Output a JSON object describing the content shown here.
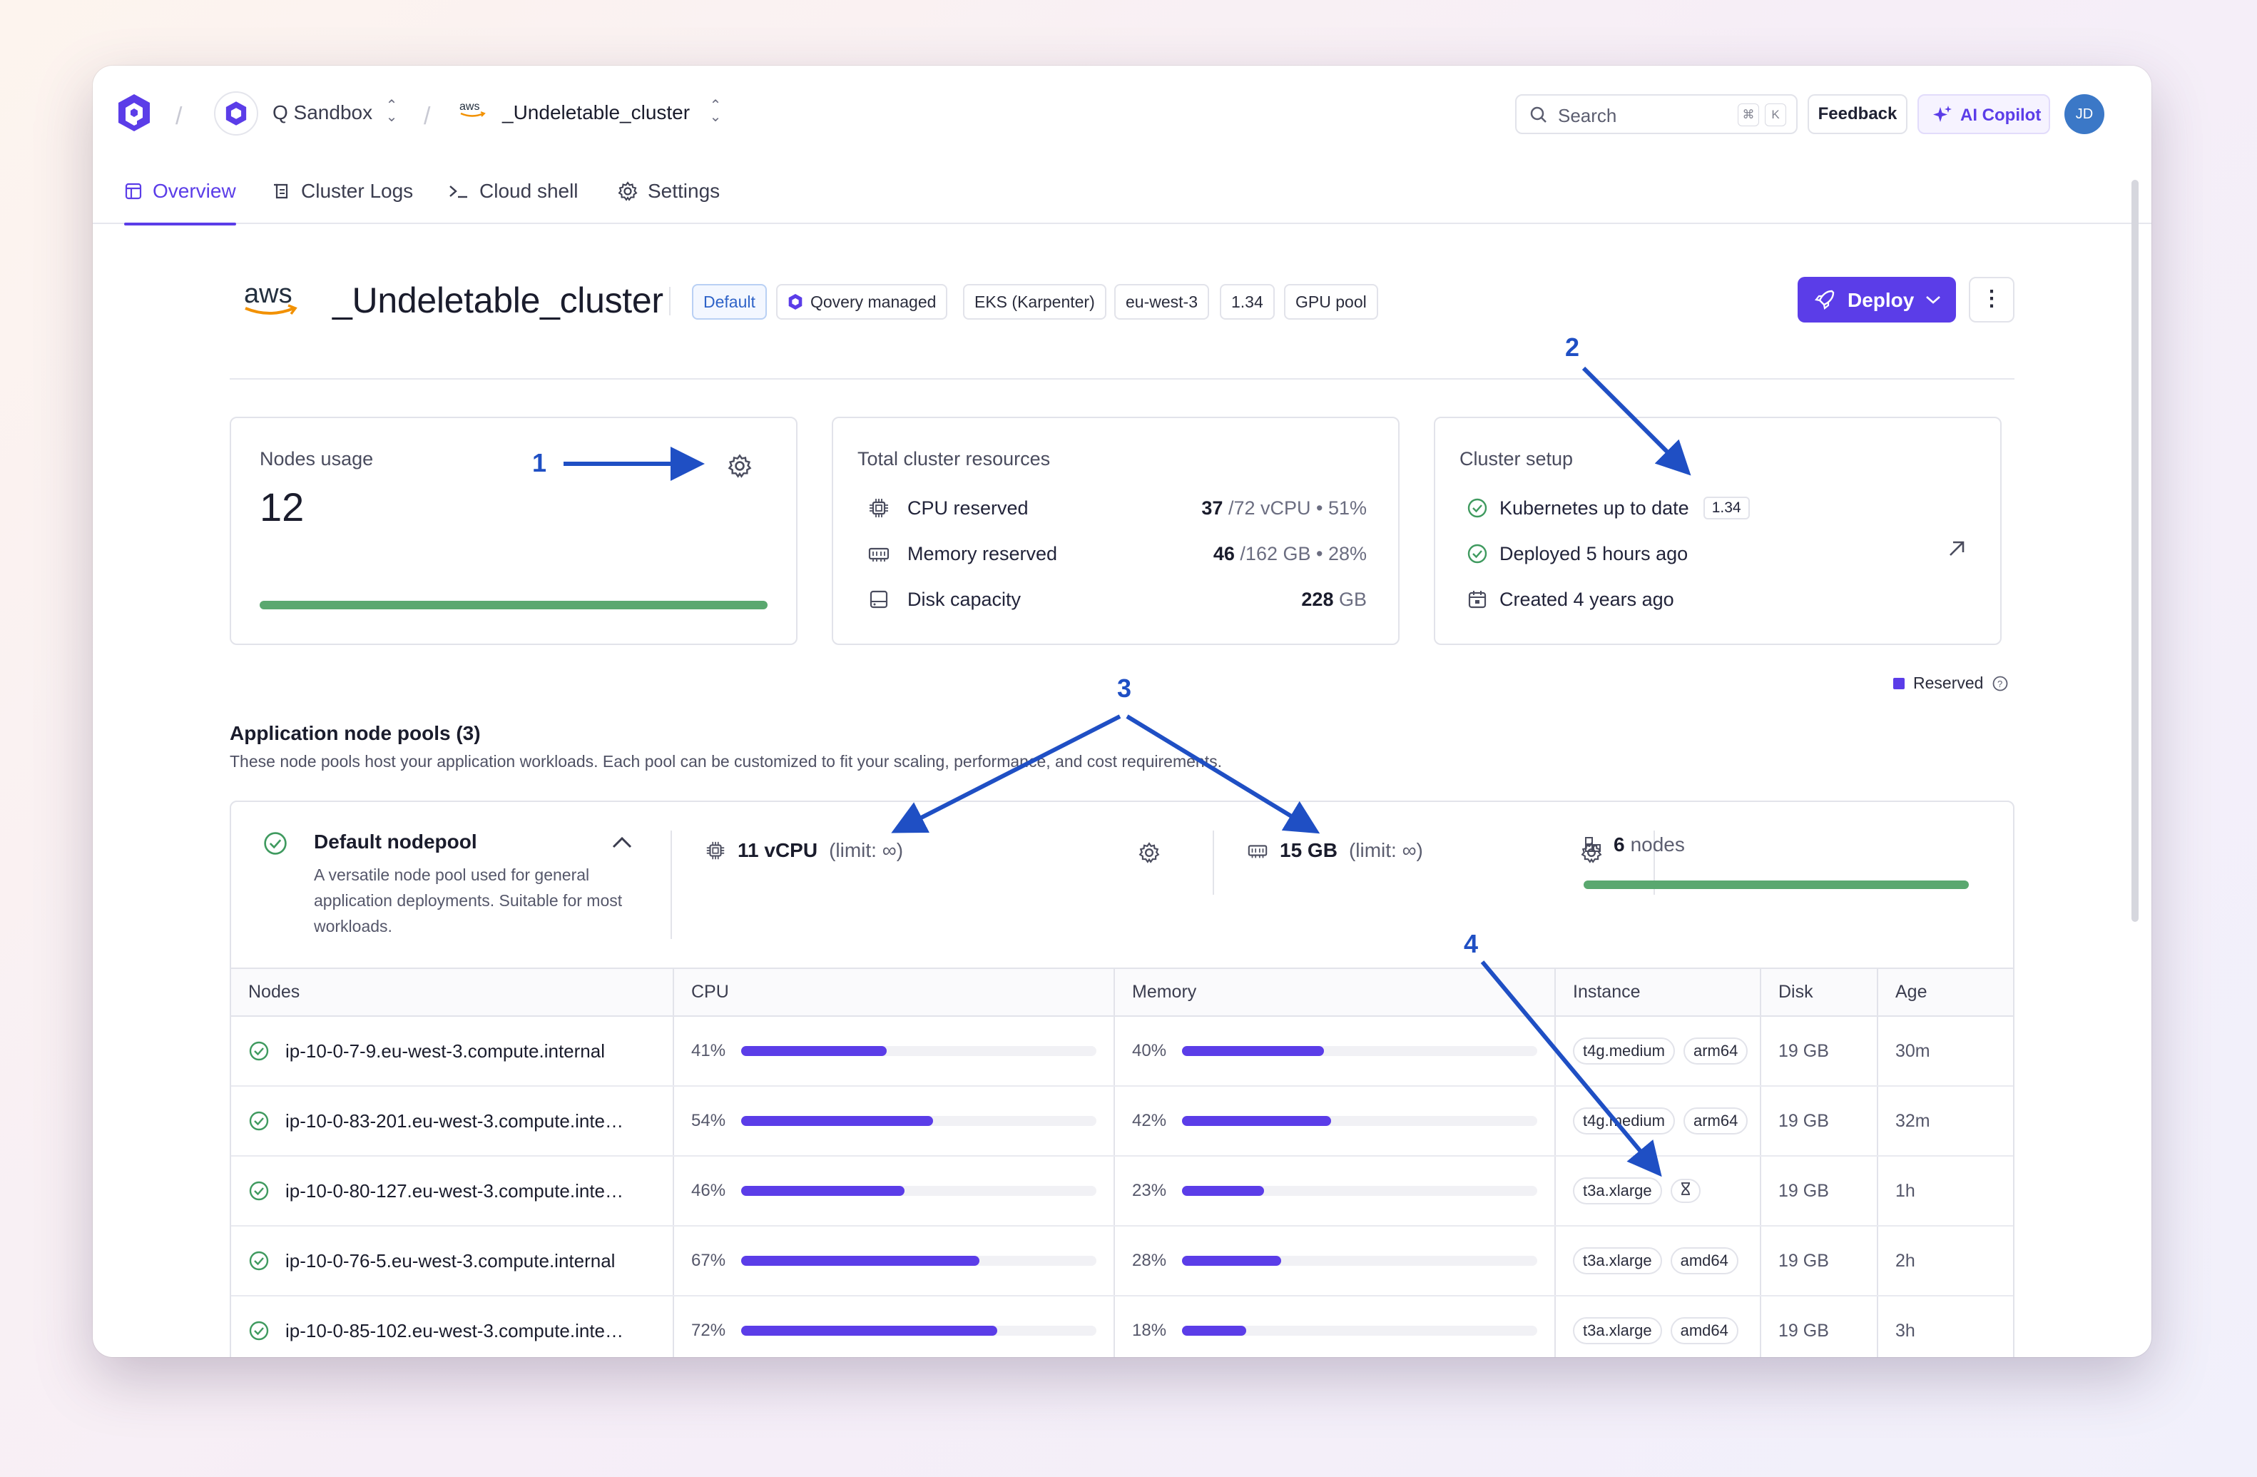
{
  "breadcrumb": {
    "project": "Q Sandbox",
    "cluster_provider": "aws",
    "cluster": "_Undeletable_cluster"
  },
  "topbar": {
    "search_placeholder": "Search",
    "shortcut_1": "⌘",
    "shortcut_2": "K",
    "feedback": "Feedback",
    "copilot": "AI Copilot",
    "user_initials": "JD"
  },
  "tabs": [
    {
      "label": "Overview",
      "icon": "layout-icon",
      "active": true
    },
    {
      "label": "Cluster Logs",
      "icon": "logs-icon",
      "active": false
    },
    {
      "label": "Cloud shell",
      "icon": "terminal-icon",
      "active": false
    },
    {
      "label": "Settings",
      "icon": "gear-icon",
      "active": false
    }
  ],
  "header": {
    "provider_logo": "aws",
    "title": "_Undeletable_cluster",
    "badges": [
      "Default",
      "Qovery managed",
      "EKS (Karpenter)",
      "eu-west-3",
      "1.34",
      "GPU pool"
    ],
    "deploy_label": "Deploy",
    "more_label": "⋮"
  },
  "nodes_usage": {
    "title": "Nodes usage",
    "count": "12",
    "usage_fraction": 1.0
  },
  "total_resources": {
    "title": "Total cluster resources",
    "rows": [
      {
        "name": "CPU reserved",
        "used": "37",
        "total": "/72 vCPU",
        "pct": "51%"
      },
      {
        "name": "Memory reserved",
        "used": "46",
        "total": "/162 GB",
        "pct": "28%"
      },
      {
        "name": "Disk capacity",
        "used": "228",
        "total": "GB",
        "pct": ""
      }
    ]
  },
  "cluster_setup": {
    "title": "Cluster setup",
    "k8s": "Kubernetes up to date",
    "k8s_version": "1.34",
    "deployed": "Deployed 5 hours ago",
    "created": "Created 4 years ago"
  },
  "legend": {
    "reserved": "Reserved"
  },
  "pools": {
    "title": "Application node pools (3)",
    "subtitle": "These node pools host your application workloads. Each pool can be customized to fit your scaling, performance, and cost requirements.",
    "default": {
      "name": "Default nodepool",
      "description": "A versatile node pool used for general application deployments. Suitable for most workloads.",
      "cpu": "11 vCPU",
      "cpu_limit": "(limit: ∞)",
      "memory": "15 GB",
      "memory_limit": "(limit: ∞)",
      "nodes_count": "6",
      "nodes_label": "nodes"
    },
    "columns": [
      "Nodes",
      "CPU",
      "Memory",
      "Instance",
      "Disk",
      "Age"
    ],
    "rows": [
      {
        "name": "ip-10-0-7-9.eu-west-3.compute.internal",
        "cpu": "41%",
        "cpu_v": 41,
        "mem": "40%",
        "mem_v": 40,
        "instance": "t4g.medium",
        "arch": "arm64",
        "disk": "19 GB",
        "age": "30m"
      },
      {
        "name": "ip-10-0-83-201.eu-west-3.compute.inte…",
        "cpu": "54%",
        "cpu_v": 54,
        "mem": "42%",
        "mem_v": 42,
        "instance": "t4g.medium",
        "arch": "arm64",
        "disk": "19 GB",
        "age": "32m"
      },
      {
        "name": "ip-10-0-80-127.eu-west-3.compute.inte…",
        "cpu": "46%",
        "cpu_v": 46,
        "mem": "23%",
        "mem_v": 23,
        "instance": "t3a.xlarge",
        "arch": "",
        "disk": "19 GB",
        "age": "1h"
      },
      {
        "name": "ip-10-0-76-5.eu-west-3.compute.internal",
        "cpu": "67%",
        "cpu_v": 67,
        "mem": "28%",
        "mem_v": 28,
        "instance": "t3a.xlarge",
        "arch": "amd64",
        "disk": "19 GB",
        "age": "2h"
      },
      {
        "name": "ip-10-0-85-102.eu-west-3.compute.inte…",
        "cpu": "72%",
        "cpu_v": 72,
        "mem": "18%",
        "mem_v": 18,
        "instance": "t3a.xlarge",
        "arch": "amd64",
        "disk": "19 GB",
        "age": "3h"
      }
    ]
  },
  "annotations": [
    "1",
    "2",
    "3",
    "4"
  ],
  "colors": {
    "accent": "#5b3de8",
    "success": "#3f9a5f",
    "annotation": "#1f4fc4"
  }
}
